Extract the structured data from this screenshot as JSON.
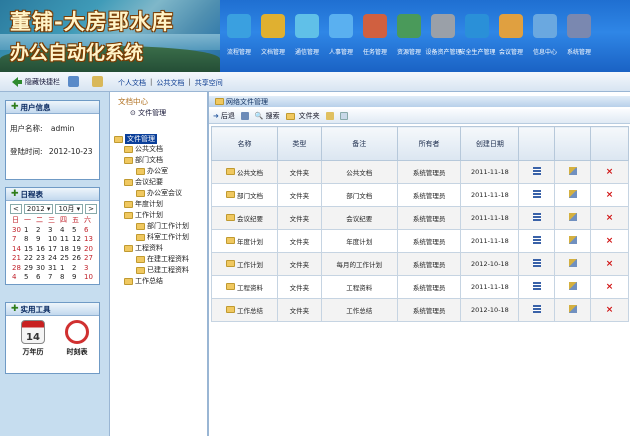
{
  "header": {
    "title_line1": "董铺-大房郢水库",
    "title_line2": "办公自动化系统",
    "nav": [
      {
        "label": "流程管理",
        "icon": "workflow-icon",
        "color": "#3aa0e0"
      },
      {
        "label": "文档管理",
        "icon": "document-icon",
        "color": "#e0b030"
      },
      {
        "label": "通信管理",
        "icon": "communication-icon",
        "color": "#60c0e8"
      },
      {
        "label": "人事管理",
        "icon": "people-icon",
        "color": "#5ab0f0"
      },
      {
        "label": "任务管理",
        "icon": "task-icon",
        "color": "#d06040"
      },
      {
        "label": "资源管理",
        "icon": "resource-icon",
        "color": "#4a9a5a"
      },
      {
        "label": "设备资产管理",
        "icon": "printer-icon",
        "color": "#9aa0a8"
      },
      {
        "label": "安全生产管理",
        "icon": "globe-icon",
        "color": "#2a90d8"
      },
      {
        "label": "会议管理",
        "icon": "meeting-icon",
        "color": "#e0a040"
      },
      {
        "label": "信息中心",
        "icon": "monitor-icon",
        "color": "#6aa8e0"
      },
      {
        "label": "系统管理",
        "icon": "system-icon",
        "color": "#7a88b0"
      }
    ]
  },
  "toolbar": {
    "hide_shortcut": "隐藏快捷栏",
    "links": [
      "个人文档",
      "公共文档",
      "共享空间"
    ],
    "separator": "|"
  },
  "user_panel": {
    "title": "用户信息",
    "username_label": "用户名称:",
    "username": "admin",
    "login_label": "登陆时间:",
    "login_time": "2012-10-23"
  },
  "calendar": {
    "title": "日程表",
    "year": "2012",
    "month": "10月",
    "weekdays": [
      "日",
      "一",
      "二",
      "三",
      "四",
      "五",
      "六"
    ],
    "days": [
      "30",
      "1",
      "2",
      "3",
      "4",
      "5",
      "6",
      "7",
      "8",
      "9",
      "10",
      "11",
      "12",
      "13",
      "14",
      "15",
      "16",
      "17",
      "18",
      "19",
      "20",
      "21",
      "22",
      "23",
      "24",
      "25",
      "26",
      "27",
      "28",
      "29",
      "30",
      "31",
      "1",
      "2",
      "3",
      "4",
      "5",
      "6",
      "7",
      "8",
      "9",
      "10"
    ]
  },
  "tools": {
    "title": "实用工具",
    "items": [
      "万年历",
      "时刻表"
    ],
    "calendar_number": "14"
  },
  "tree": {
    "header": "文档中心",
    "sub": "文件管理",
    "root": "文件管理",
    "nodes": [
      "公共文档",
      "部门文档",
      "办公室",
      "会议纪要",
      "办公室会议",
      "年度计划",
      "工作计划",
      "部门工作计划",
      "科室工作计划",
      "工程资料",
      "在建工程资料",
      "已建工程资料",
      "工作总结"
    ]
  },
  "main": {
    "breadcrumb": "网络文件管理",
    "buttons": [
      "后退",
      "搜索",
      "文件夹"
    ],
    "columns": [
      "名称",
      "类型",
      "备注",
      "所有者",
      "创建日期",
      "",
      "",
      ""
    ],
    "rows": [
      {
        "name": "公共文档",
        "type": "文件夹",
        "note": "公共文档",
        "owner": "系统管理员",
        "date": "2011-11-18"
      },
      {
        "name": "部门文档",
        "type": "文件夹",
        "note": "部门文档",
        "owner": "系统管理员",
        "date": "2011-11-18"
      },
      {
        "name": "会议纪要",
        "type": "文件夹",
        "note": "会议纪要",
        "owner": "系统管理员",
        "date": "2011-11-18"
      },
      {
        "name": "年度计划",
        "type": "文件夹",
        "note": "年度计划",
        "owner": "系统管理员",
        "date": "2011-11-18"
      },
      {
        "name": "工作计划",
        "type": "文件夹",
        "note": "每月的工作计划",
        "owner": "系统管理员",
        "date": "2012-10-18"
      },
      {
        "name": "工程资料",
        "type": "文件夹",
        "note": "工程资料",
        "owner": "系统管理员",
        "date": "2011-11-18"
      },
      {
        "name": "工作总结",
        "type": "文件夹",
        "note": "工作总结",
        "owner": "系统管理员",
        "date": "2012-10-18"
      }
    ],
    "delete_symbol": "×"
  }
}
